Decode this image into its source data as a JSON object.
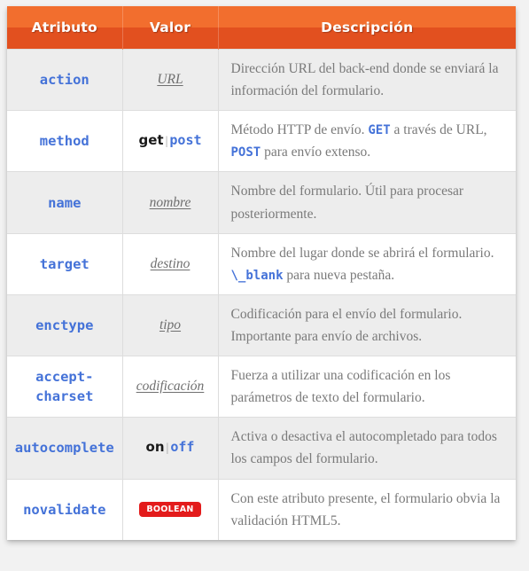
{
  "table": {
    "headers": [
      {
        "label": "Atributo",
        "name": "column-header-atributo"
      },
      {
        "label": "Valor",
        "name": "column-header-valor"
      },
      {
        "label": "Descripción",
        "name": "column-header-descripcion"
      }
    ],
    "rows": [
      {
        "attribute": "action",
        "value_type": "placeholder",
        "value": "URL",
        "description_parts": [
          {
            "text": "Dirección URL del back-end donde se enviará la información del formulario.",
            "style": "text"
          }
        ]
      },
      {
        "attribute": "method",
        "value_type": "keywords",
        "value": "get | post",
        "keywords": [
          {
            "text": "get",
            "style": "bold"
          },
          {
            "text": "|",
            "style": "separator"
          },
          {
            "text": "post",
            "style": "code"
          }
        ],
        "description_parts": [
          {
            "text": "Método HTTP de envío. ",
            "style": "text"
          },
          {
            "text": "GET",
            "style": "code"
          },
          {
            "text": " a través de URL, ",
            "style": "text"
          },
          {
            "text": "POST",
            "style": "code"
          },
          {
            "text": " para envío extenso.",
            "style": "text"
          }
        ]
      },
      {
        "attribute": "name",
        "value_type": "placeholder",
        "value": "nombre",
        "description_parts": [
          {
            "text": "Nombre del formulario. Útil para procesar posteriormente.",
            "style": "text"
          }
        ]
      },
      {
        "attribute": "target",
        "value_type": "placeholder",
        "value": "destino",
        "description_parts": [
          {
            "text": "Nombre del lugar donde se abrirá el formulario. ",
            "style": "text"
          },
          {
            "text": "\\_blank",
            "style": "code"
          },
          {
            "text": " para nueva pestaña.",
            "style": "text"
          }
        ]
      },
      {
        "attribute": "enctype",
        "value_type": "placeholder",
        "value": "tipo",
        "description_parts": [
          {
            "text": "Codificación para el envío del formulario. Importante para envío de archivos.",
            "style": "text"
          }
        ]
      },
      {
        "attribute": "accept-charset",
        "value_type": "placeholder",
        "value": "codificación",
        "description_parts": [
          {
            "text": "Fuerza a utilizar una codificación en los parámetros de texto del formulario.",
            "style": "text"
          }
        ]
      },
      {
        "attribute": "autocomplete",
        "value_type": "keywords",
        "value": "on | off",
        "keywords": [
          {
            "text": "on",
            "style": "bold"
          },
          {
            "text": "|",
            "style": "separator"
          },
          {
            "text": "off",
            "style": "code"
          }
        ],
        "description_parts": [
          {
            "text": "Activa o desactiva el autocompletado para todos los campos del formulario.",
            "style": "text"
          }
        ]
      },
      {
        "attribute": "novalidate",
        "value_type": "badge",
        "value": "BOOLEAN",
        "description_parts": [
          {
            "text": "Con este atributo presente, el formulario obvia la validación HTML5.",
            "style": "text"
          }
        ]
      }
    ]
  },
  "colors": {
    "header_gradient_top": "#f26e2e",
    "header_gradient_bottom": "#e2501f",
    "attribute_text": "#4472d8",
    "description_text": "#7a7a7a",
    "badge_background": "#e31b1b",
    "stripe_background": "#ededed",
    "page_background": "#f2f2f2"
  }
}
